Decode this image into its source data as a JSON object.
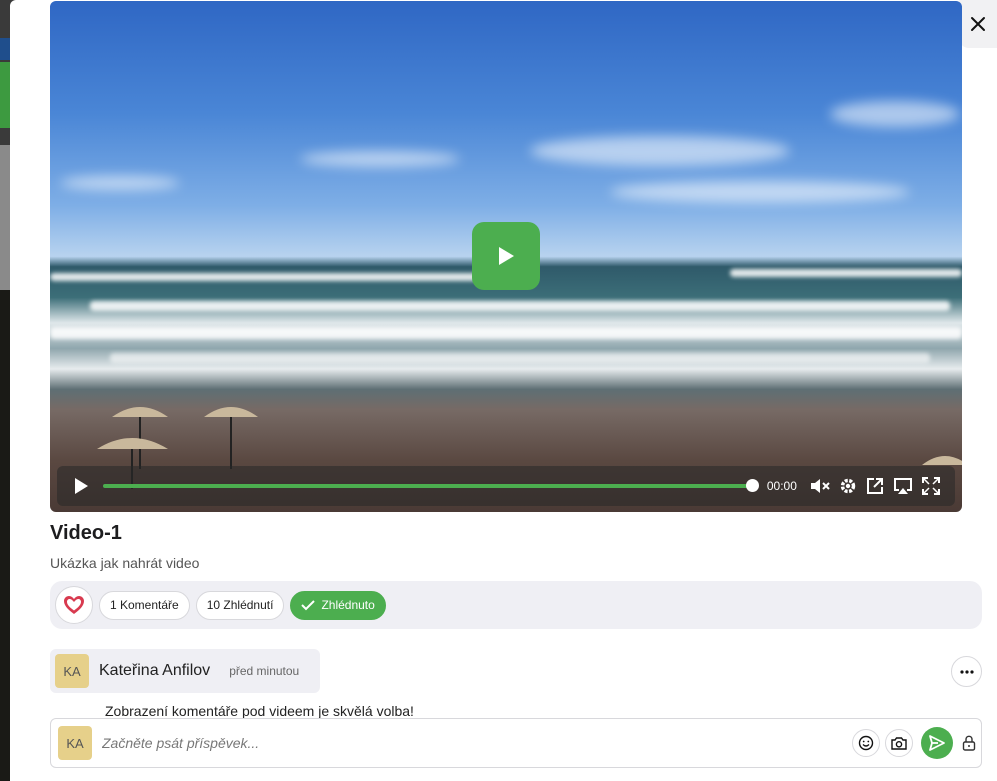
{
  "modal": {
    "close_icon": "close-icon"
  },
  "video": {
    "play_icon": "play-icon",
    "controls": {
      "time": "00:00",
      "progress_fraction": 1.0,
      "icons": [
        "play-icon",
        "mute-icon",
        "settings-icon",
        "external-link-icon",
        "airplay-icon",
        "fullscreen-icon"
      ]
    }
  },
  "info": {
    "title": "Video-1",
    "subtitle": "Ukázka jak nahrát video"
  },
  "actions": {
    "like_icon": "heart-icon",
    "comments_label": "1 Komentáře",
    "views_label": "10 Zhlédnutí",
    "watched_label": "Zhlédnuto"
  },
  "comment": {
    "avatar_initials": "KA",
    "author": "Kateřina Anfilov",
    "time": "před minutou",
    "text": "Zobrazení komentáře pod videem je skvělá volba!"
  },
  "composer": {
    "avatar_initials": "KA",
    "placeholder": "Začněte psát příspěvek..."
  },
  "colors": {
    "accent": "#4cae4f",
    "heart": "#d83a4f",
    "avatar_bg": "#e6d08a",
    "panel_bg": "#efeff4"
  }
}
